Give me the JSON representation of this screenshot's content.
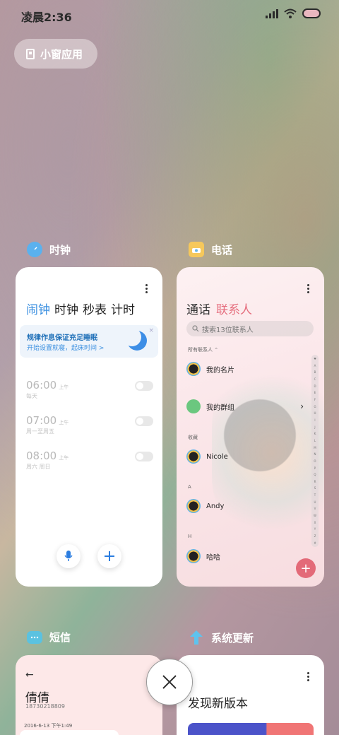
{
  "status_bar": {
    "time": "凌晨2:36"
  },
  "floating_window_button": {
    "label": "小窗应用"
  },
  "apps": {
    "clock": {
      "name": "时钟",
      "tabs": [
        "闹钟",
        "时钟",
        "秒表",
        "计时"
      ],
      "banner": {
        "title": "规律作息保证充足睡眠",
        "subtitle": "开始设置就寝，起床时间 >",
        "close": "×"
      },
      "alarms": [
        {
          "time": "06:00",
          "ampm": "上午",
          "days": "每天",
          "enabled": false
        },
        {
          "time": "07:00",
          "ampm": "上午",
          "days": "周一至周五",
          "enabled": false
        },
        {
          "time": "08:00",
          "ampm": "上午",
          "days": "周六 周日",
          "enabled": false
        }
      ]
    },
    "phone": {
      "name": "电话",
      "tabs": [
        "通话",
        "联系人"
      ],
      "search_placeholder": "搜索13位联系人",
      "filter_label": "所有联系人 ⌃",
      "section_favorites": "收藏",
      "section_a": "A",
      "section_h": "H",
      "contacts": [
        "我的名片",
        "我的群组",
        "Nicole",
        "Andy",
        "哈哈"
      ],
      "index_letters": [
        "♥",
        "A",
        "B",
        "C",
        "D",
        "E",
        "F",
        "G",
        "H",
        "I",
        "J",
        "K",
        "L",
        "M",
        "N",
        "O",
        "P",
        "Q",
        "R",
        "S",
        "T",
        "U",
        "V",
        "W",
        "X",
        "Y",
        "Z",
        "#"
      ],
      "fab": "+"
    },
    "sms": {
      "name": "短信",
      "back": "←",
      "contact_name": "倩倩",
      "contact_number": "18730218809",
      "date": "2016-6-13 下午1:49"
    },
    "update": {
      "name": "系统更新",
      "title": "发现新版本"
    }
  },
  "close_all": "×"
}
